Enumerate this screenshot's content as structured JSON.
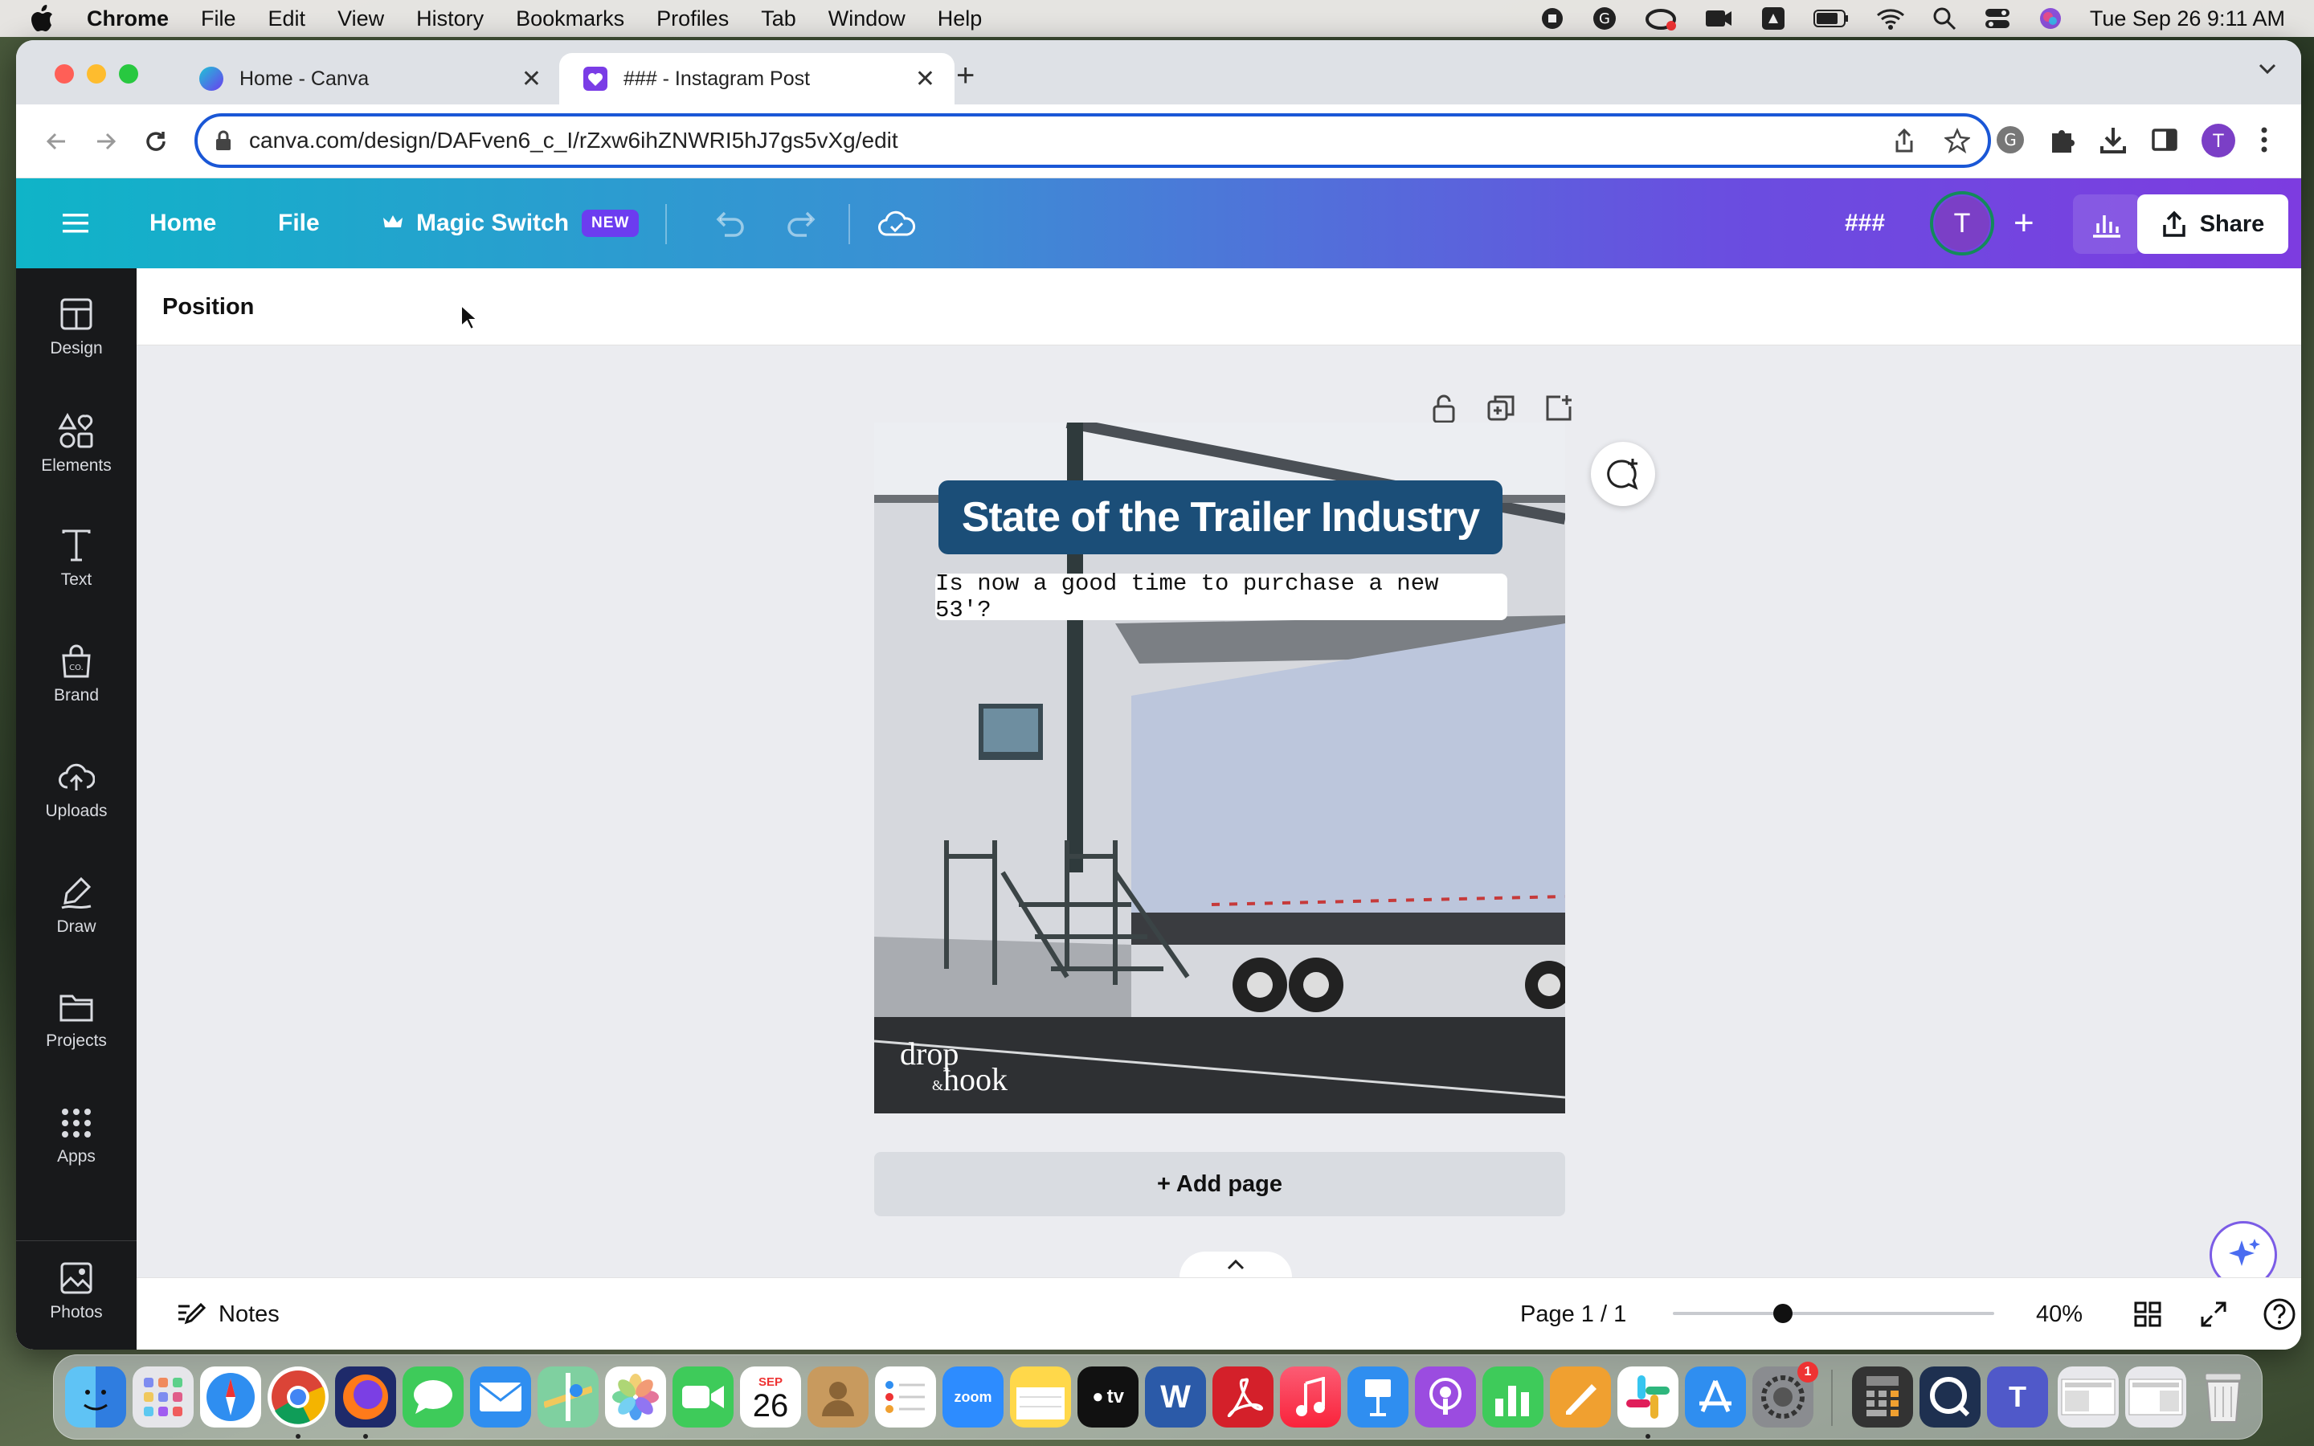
{
  "menubar": {
    "app": "Chrome",
    "items": [
      "File",
      "Edit",
      "View",
      "History",
      "Bookmarks",
      "Profiles",
      "Tab",
      "Window",
      "Help"
    ],
    "datetime": "Tue Sep 26  9:11 AM"
  },
  "browser": {
    "tabs": [
      {
        "title": "Home - Canva"
      },
      {
        "title": "### - Instagram Post"
      }
    ],
    "url": "canva.com/design/DAFven6_c_I/rZxw6ihZNWRI5hJ7gs5vXg/edit",
    "profile_initial": "T"
  },
  "canva": {
    "nav": {
      "home": "Home",
      "file": "File",
      "magic_switch": "Magic Switch",
      "new_badge": "NEW"
    },
    "design_name": "###",
    "avatar_initial": "T",
    "share": "Share",
    "sidebar": [
      {
        "label": "Design",
        "icon": "layout-icon"
      },
      {
        "label": "Elements",
        "icon": "shapes-icon"
      },
      {
        "label": "Text",
        "icon": "text-icon"
      },
      {
        "label": "Brand",
        "icon": "brand-icon"
      },
      {
        "label": "Uploads",
        "icon": "cloud-upload-icon"
      },
      {
        "label": "Draw",
        "icon": "pen-icon"
      },
      {
        "label": "Projects",
        "icon": "folder-icon"
      },
      {
        "label": "Apps",
        "icon": "grid-dots-icon"
      },
      {
        "label": "Photos",
        "icon": "image-icon"
      }
    ],
    "context_bar": "Position",
    "post": {
      "title": "State of the Trailer Industry",
      "subtitle": "Is now a good time to purchase a new 53'?",
      "logo_line1": "drop",
      "logo_amp": "&",
      "logo_line2": "hook"
    },
    "add_page": "+ Add page",
    "notes": "Notes",
    "page_indicator": "Page 1 / 1",
    "zoom": "40%",
    "zoom_level": 0.4
  },
  "dock": {
    "calendar_month": "SEP",
    "calendar_day": "26",
    "zoom_label": "zoom",
    "tv_label": "tv",
    "settings_badge": "1"
  },
  "colors": {
    "canva_gradient_start": "#0fb4c8",
    "canva_gradient_end": "#7d3ce0",
    "title_box": "#1b4e78",
    "sidebar": "#18191b",
    "address_focus": "#1a57d6"
  }
}
